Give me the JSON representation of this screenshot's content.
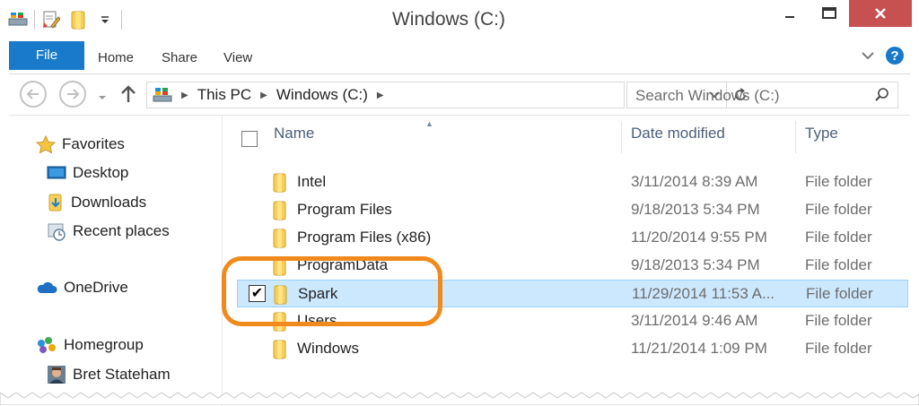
{
  "window": {
    "title": "Windows (C:)",
    "colors": {
      "ribbon_file_tab": "#1979ca",
      "close_button": "#c75050",
      "selection": "#cce8ff",
      "highlight_ring": "#f18a1c"
    }
  },
  "ribbon": {
    "tabs": [
      "File",
      "Home",
      "Share",
      "View"
    ]
  },
  "address": {
    "breadcrumb": [
      "This PC",
      "Windows (C:)"
    ]
  },
  "search": {
    "placeholder": "Search Windows (C:)"
  },
  "nav_pane": {
    "favorites": {
      "label": "Favorites",
      "items": [
        "Desktop",
        "Downloads",
        "Recent places"
      ]
    },
    "onedrive": {
      "label": "OneDrive"
    },
    "homegroup": {
      "label": "Homegroup",
      "items": [
        "Bret Stateham"
      ]
    }
  },
  "columns": {
    "name": "Name",
    "date": "Date modified",
    "type": "Type"
  },
  "rows": [
    {
      "name": "Intel",
      "date": "3/11/2014 8:39 AM",
      "type": "File folder"
    },
    {
      "name": "Program Files",
      "date": "9/18/2013 5:34 PM",
      "type": "File folder"
    },
    {
      "name": "Program Files (x86)",
      "date": "11/20/2014 9:55 PM",
      "type": "File folder"
    },
    {
      "name": "ProgramData",
      "date": "9/18/2013 5:34 PM",
      "type": "File folder"
    },
    {
      "name": "Spark",
      "date": "11/29/2014 11:53 A...",
      "type": "File folder",
      "selected": true
    },
    {
      "name": "Users",
      "date": "3/11/2014 9:46 AM",
      "type": "File folder"
    },
    {
      "name": "Windows",
      "date": "11/21/2014 1:09 PM",
      "type": "File folder"
    }
  ]
}
